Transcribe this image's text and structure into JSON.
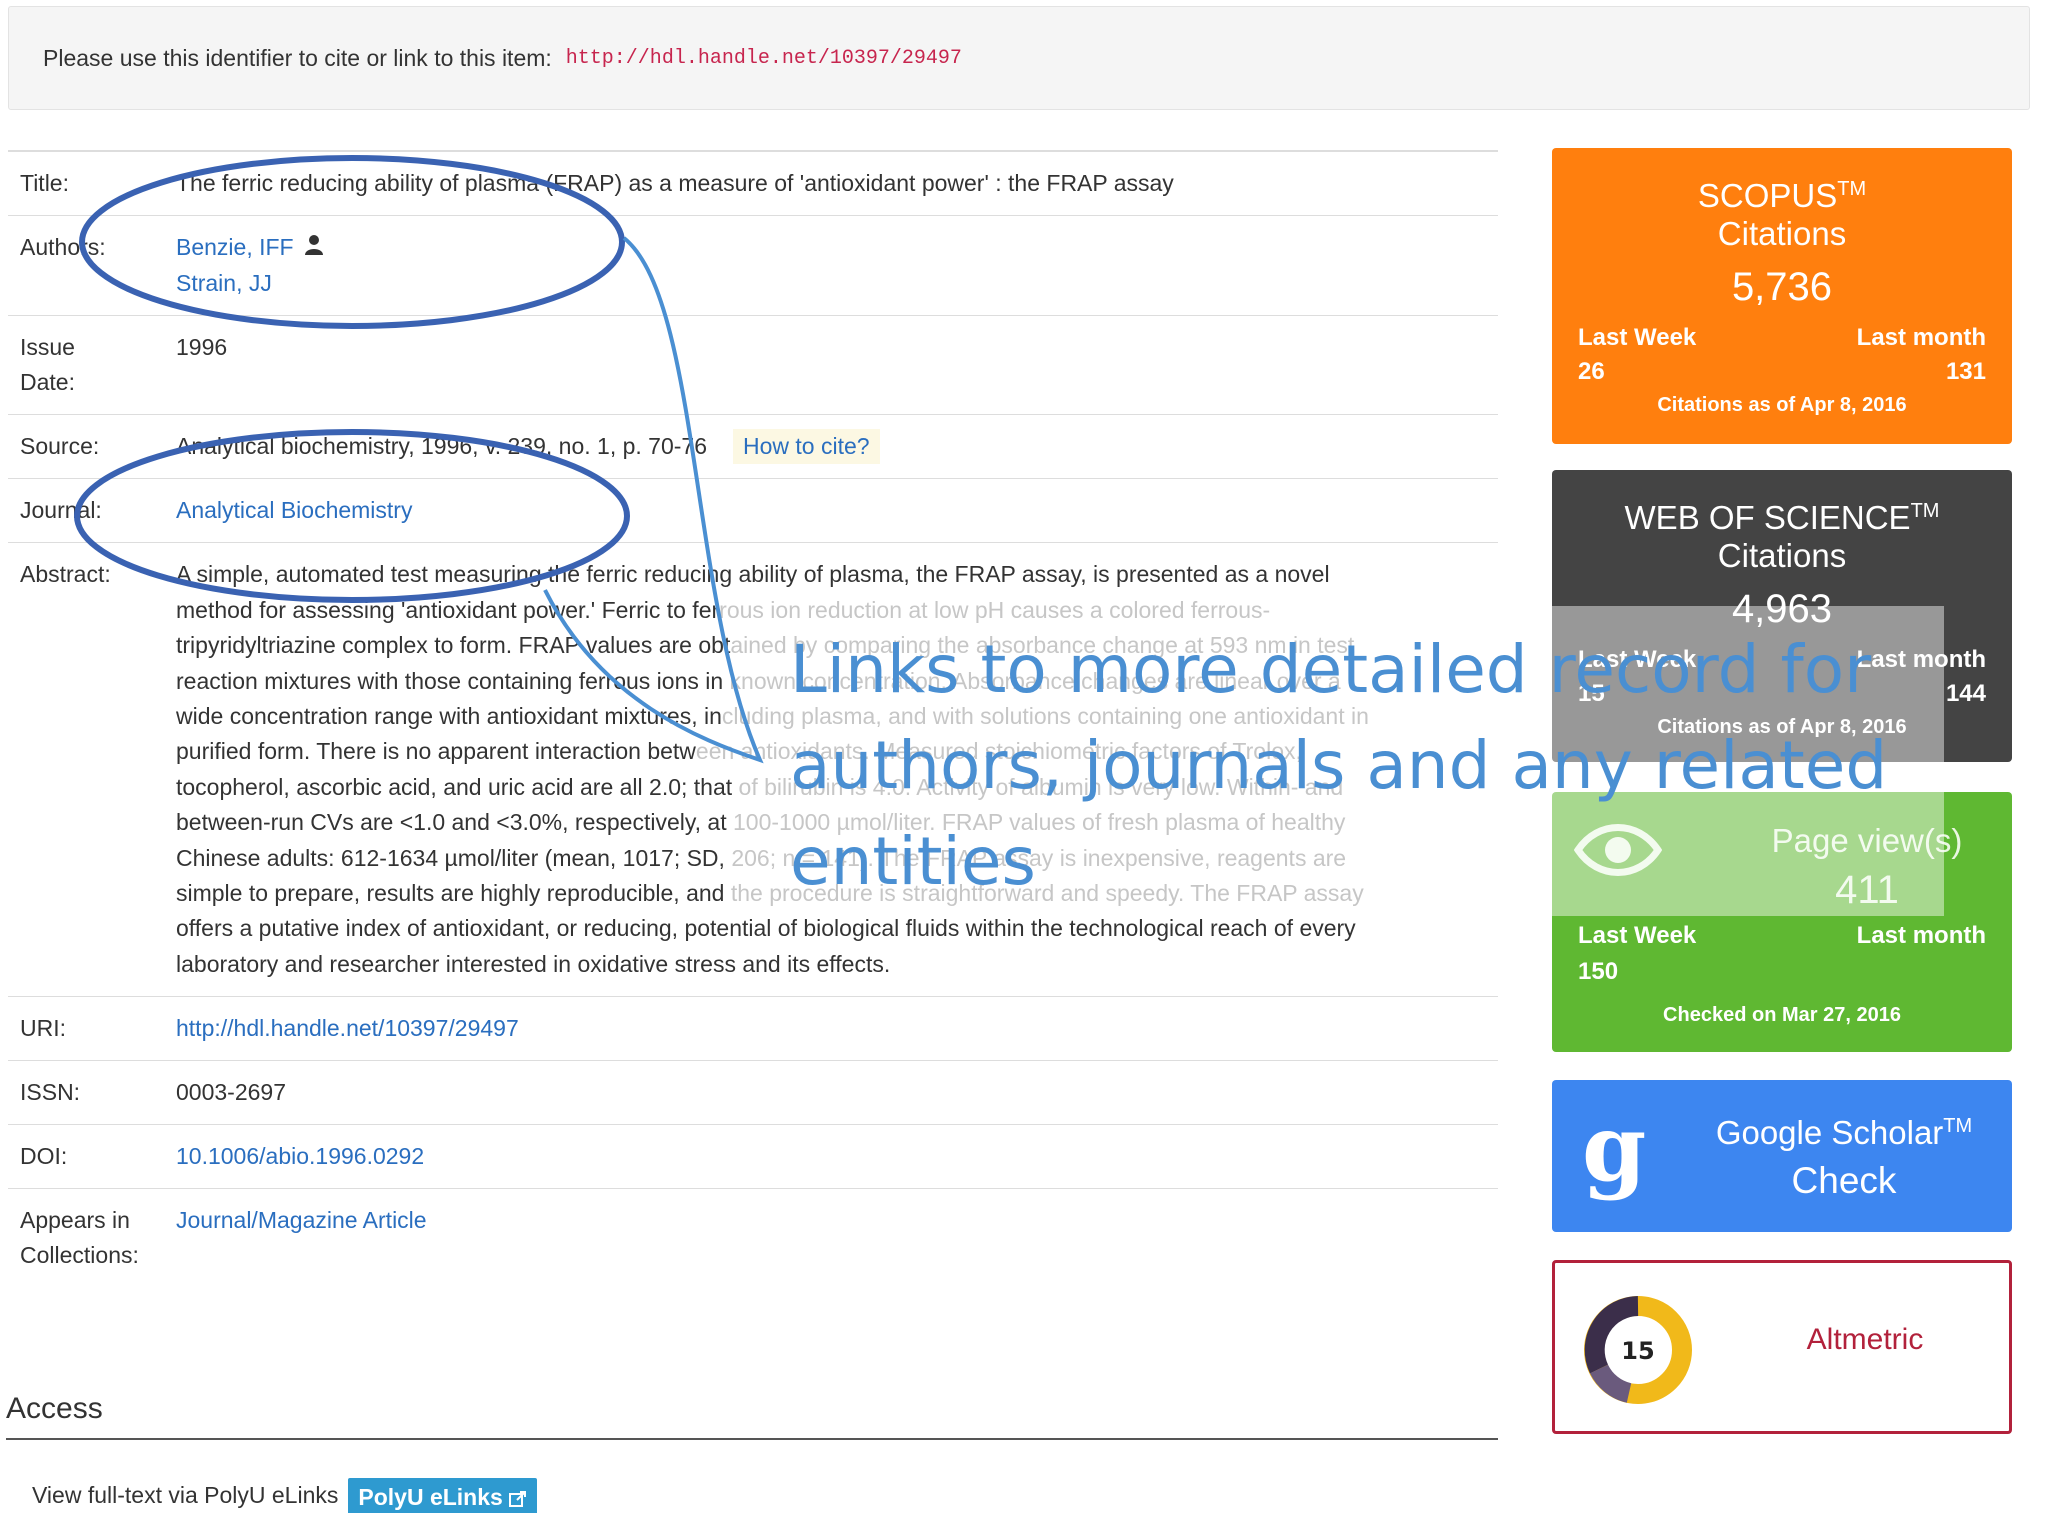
{
  "cite": {
    "label": "Please use this identifier to cite or link to this item:",
    "link": "http://hdl.handle.net/10397/29497"
  },
  "record": {
    "title_label": "Title:",
    "title": "The ferric reducing ability of plasma (FRAP) as a measure of 'antioxidant power' : the FRAP assay",
    "authors_label": "Authors:",
    "authors": [
      "Benzie, IFF",
      "Strain, JJ"
    ],
    "issue_label_1": "Issue",
    "issue_label_2": "Date:",
    "issue_date": "1996",
    "source_label": "Source:",
    "source": "Analytical biochemistry, 1996, v. 239, no. 1, p. 70-76",
    "how_to_cite": "How to cite?",
    "journal_label": "Journal:",
    "journal": "Analytical Biochemistry",
    "abstract_label": "Abstract:",
    "abstract_lines": [
      {
        "dark": "A simple, automated test measuring the ferric reducing ability of plasma, the FRAP assay, is presented as a novel",
        "faded": ""
      },
      {
        "dark": "method for assessing 'antioxidant power.' Ferric to fer",
        "faded": "rous ion reduction at low pH causes a colored ferrous-"
      },
      {
        "dark": "tripyridyltriazine complex to form. FRAP values are obt",
        "faded": "ained by comparing the absorbance change at 593 nm in test"
      },
      {
        "dark": "reaction mixtures with those containing ferrous ions in",
        "faded": " known concentration. Absorbance changes are linear over a"
      },
      {
        "dark": "wide concentration range with antioxidant mixtures, in",
        "faded": "cluding plasma, and with solutions containing one antioxidant in"
      },
      {
        "dark": "purified form. There is no apparent interaction betw",
        "faded": "een antioxidants. Measured stoichiometric factors of Trolox,"
      },
      {
        "dark": "tocopherol, ascorbic acid, and uric acid are all 2.0; that",
        "faded": " of bilirubin is 4.0. Activity of albumin is very low. Within- and"
      },
      {
        "dark": "between-run CVs are <1.0 and <3.0%, respectively, at",
        "faded": " 100-1000 µmol/liter. FRAP values of fresh plasma of healthy"
      },
      {
        "dark": "Chinese adults: 612-1634 µmol/liter (mean, 1017; SD,",
        "faded": " 206; n = 141). The FRAP assay is inexpensive, reagents are"
      },
      {
        "dark": "simple to prepare, results are highly reproducible, and",
        "faded": " the procedure is straightforward and speedy. The FRAP assay"
      },
      {
        "dark": "offers a putative index of antioxidant, or reducing, potential of biological fluids within the technological reach of every",
        "faded": ""
      },
      {
        "dark": "laboratory and researcher interested in oxidative stress and its effects.",
        "faded": ""
      }
    ],
    "uri_label": "URI:",
    "uri": "http://hdl.handle.net/10397/29497",
    "issn_label": "ISSN:",
    "issn": "0003-2697",
    "doi_label": "DOI:",
    "doi": "10.1006/abio.1996.0292",
    "appears_label_1": "Appears in",
    "appears_label_2": "Collections:",
    "collection": "Journal/Magazine Article"
  },
  "access": {
    "heading": "Access",
    "fulltext_label": "View full-text via PolyU eLinks",
    "elinks_button": "PolyU eLinks"
  },
  "scopus": {
    "title": "SCOPUS",
    "tm": "TM",
    "subtitle": "Citations",
    "count": "5,736",
    "last_week_label": "Last Week",
    "last_month_label": "Last month",
    "last_week": "26",
    "last_month": "131",
    "as_of": "Citations as of Apr 8, 2016",
    "color": "#ff7f0e"
  },
  "wos": {
    "title": "WEB OF SCIENCE",
    "tm": "TM",
    "subtitle": "Citations",
    "count": "4,963",
    "last_week_label": "Last Week",
    "last_month_label": "Last month",
    "last_week": "15",
    "last_month": "144",
    "as_of": "Citations as of Apr 8, 2016",
    "color": "#444444"
  },
  "views": {
    "title": "Page view(s)",
    "count": "411",
    "last_week_label": "Last Week",
    "last_month_label": "Last month",
    "last_week": "150",
    "as_of": "Checked on Mar 27, 2016",
    "icon": "eye-icon",
    "color": "#5fb832"
  },
  "gscholar": {
    "title": "Google Scholar",
    "tm": "TM",
    "action": "Check",
    "icon": "google-scholar-icon",
    "color": "#3d86f0"
  },
  "altmetric": {
    "score": "15",
    "label": "Altmetric",
    "icon": "altmetric-donut-icon",
    "color": "#b2213b"
  },
  "annotation": {
    "callout_lines": [
      "Links to more detailed record for",
      "authors, journals and any related",
      "entities"
    ],
    "color": "#4a8fd2"
  }
}
